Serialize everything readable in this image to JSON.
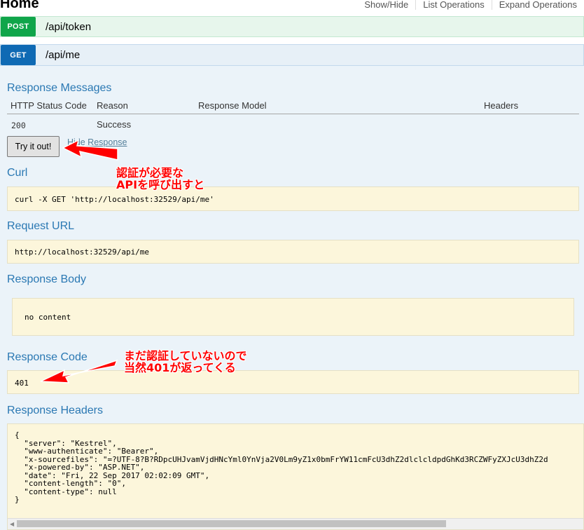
{
  "header": {
    "title": "Home",
    "links": [
      "Show/Hide",
      "List Operations",
      "Expand Operations"
    ]
  },
  "operations": [
    {
      "verb": "POST",
      "path": "/api/token"
    },
    {
      "verb": "GET",
      "path": "/api/me"
    }
  ],
  "response_messages": {
    "heading": "Response Messages",
    "columns": [
      "HTTP Status Code",
      "Reason",
      "Response Model",
      "Headers"
    ],
    "rows": [
      {
        "code": "200",
        "reason": "Success"
      }
    ]
  },
  "buttons": {
    "try_it_out": "Try it out!",
    "hide_response": "Hide Response"
  },
  "curl": {
    "heading": "Curl",
    "value": "curl -X GET 'http://localhost:32529/api/me'"
  },
  "request_url": {
    "heading": "Request URL",
    "value": "http://localhost:32529/api/me"
  },
  "response_body": {
    "heading": "Response Body",
    "value": "no content"
  },
  "response_code": {
    "heading": "Response Code",
    "value": "401"
  },
  "response_headers": {
    "heading": "Response Headers",
    "value": "{\n  \"server\": \"Kestrel\",\n  \"www-authenticate\": \"Bearer\",\n  \"x-sourcefiles\": \"=?UTF-8?B?RDpcUHJvamVjdHNcYml0YnVja2V0Lm9yZ1x0bmFrYW11cmFcU3dhZ2dlclcldpdGhKd3RCZWFyZXJcU3dhZ2d\n  \"x-powered-by\": \"ASP.NET\",\n  \"date\": \"Fri, 22 Sep 2017 02:02:09 GMT\",\n  \"content-length\": \"0\",\n  \"content-type\": null\n}"
  },
  "annotations": {
    "note1_line1": "認証が必要な",
    "note1_line2": "APIを呼び出すと",
    "note2_line1": "まだ認証していないので",
    "note2_line2": "当然401が返ってくる",
    "color": "#ff0000"
  },
  "colors": {
    "post": "#10a54a",
    "get": "#0f6ab4",
    "heading": "#2a78b3",
    "code_bg": "#fcf6db"
  }
}
